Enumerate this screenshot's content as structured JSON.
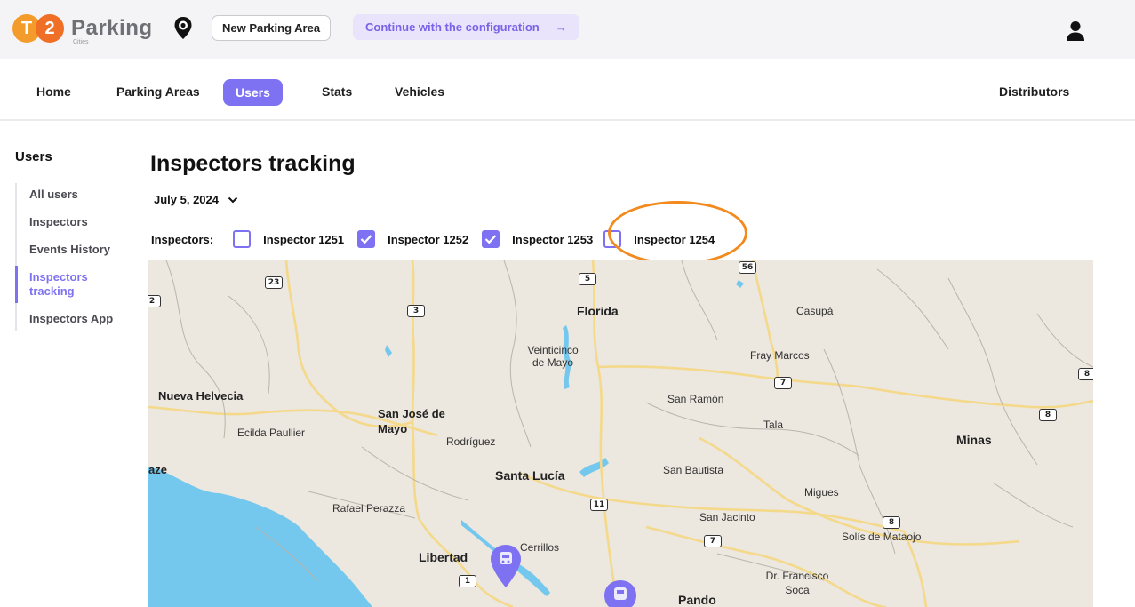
{
  "header": {
    "logo_letters": [
      "T",
      "2"
    ],
    "logo_word": "Parking",
    "logo_sub": "Cities",
    "new_area_label": "New Parking Area",
    "continue_label": "Continue with the configuration",
    "continue_arrow": "→"
  },
  "nav": {
    "items": [
      "Home",
      "Parking Areas",
      "Users",
      "Stats",
      "Vehicles"
    ],
    "active": "Users",
    "right_item": "Distributors"
  },
  "sidebar": {
    "title": "Users",
    "items": [
      "All users",
      "Inspectors",
      "Events History",
      "Inspectors tracking",
      "Inspectors App"
    ],
    "active": "Inspectors tracking"
  },
  "main": {
    "title": "Inspectors tracking",
    "date": "July 5, 2024",
    "inspectors_label": "Inspectors:",
    "inspectors": [
      {
        "label": "Inspector 1251",
        "checked": false
      },
      {
        "label": "Inspector 1252",
        "checked": true
      },
      {
        "label": "Inspector 1253",
        "checked": true
      },
      {
        "label": "Inspector 1254",
        "checked": false
      }
    ]
  },
  "map": {
    "towns": [
      "Florida",
      "Casupá",
      "Veinticinco de Mayo",
      "Fray Marcos",
      "Nueva Helvecia",
      "San Ramón",
      "San José de Mayo",
      "Tala",
      "Ecilda Paullier",
      "Rodríguez",
      "Minas",
      "Santa Lucía",
      "San Bautista",
      "Migues",
      "Rafael Perazza",
      "San Jacinto",
      "Cerrillos",
      "Solís de Mataojo",
      "Libertad",
      "Dr. Francisco Soca",
      "Pando",
      "aze"
    ],
    "route_numbers": [
      "23",
      "2",
      "3",
      "5",
      "56",
      "7",
      "8",
      "8",
      "11",
      "7",
      "8",
      "1"
    ],
    "colors": {
      "land": "#ece7df",
      "water": "#74c8ee",
      "road": "#f4d98a",
      "marker": "#7e72f2"
    }
  },
  "colors": {
    "accent": "#7e72f2",
    "highlight": "#f28a1e",
    "logo_t": "#f39c2c",
    "logo_2": "#ef6f26"
  }
}
